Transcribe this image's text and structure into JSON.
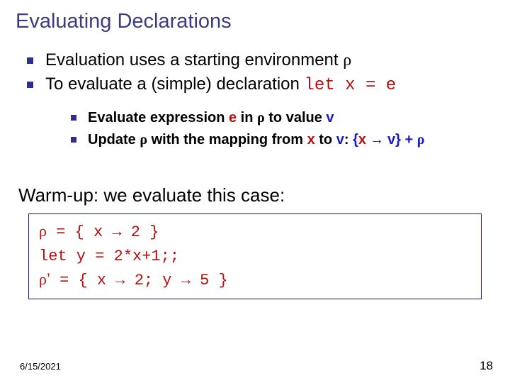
{
  "title": "Evaluating Declarations",
  "b1": {
    "pre": "Evaluation uses a starting environment ",
    "rho": "ρ"
  },
  "b2": {
    "pre": "To evaluate a (simple) declaration ",
    "code": "let x = e"
  },
  "s1": {
    "t1": "Evaluate ",
    "t2": "expression ",
    "e": "e",
    "t3": " in ",
    "rho": "ρ",
    "t4": " to value ",
    "v": "v"
  },
  "s2": {
    "t1": "Update ",
    "rho1": "ρ",
    "t2": " with the mapping from ",
    "x": "x",
    "t3": " to ",
    "v": "v",
    "t4": ":  ",
    "brace_open": "{",
    "x2": "x",
    "arrow": " → ",
    "v2": "v",
    "brace_close": "}",
    "plus": " + ",
    "rho2": "ρ"
  },
  "warmup": "Warm-up: we evaluate this case:",
  "code": {
    "l1_rho": "ρ",
    "l1_rest": " = { x → 2 }",
    "l2": "let y = 2*x+1;;",
    "l3_rho": "ρ",
    "l3_prime": "’",
    "l3_rest": " = { x → 2; y → 5 }"
  },
  "footer": {
    "date": "6/15/2021",
    "page": "18"
  }
}
